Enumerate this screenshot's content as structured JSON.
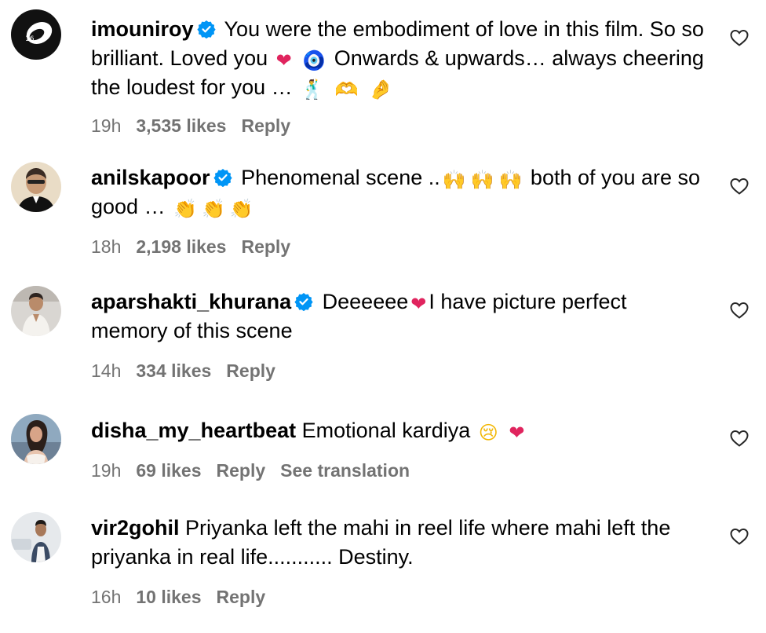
{
  "comments": [
    {
      "username": "imouniroy",
      "verified": true,
      "parts": [
        "You were the embodiment of love in this film. So so brilliant. Loved you",
        "❤",
        "🧿",
        "Onwards & upwards… always cheering the loudest for you …",
        "🕺",
        "🫶",
        "🤌"
      ],
      "time": "19h",
      "likes": "3,535 likes",
      "reply": "Reply"
    },
    {
      "username": "anilskapoor",
      "verified": true,
      "parts": [
        "Phenomenal scene ..",
        "🙌",
        "🙌",
        "🙌",
        "both of you are so good …",
        "👏",
        "👏",
        "👏"
      ],
      "time": "18h",
      "likes": "2,198 likes",
      "reply": "Reply"
    },
    {
      "username": "aparshakti_khurana",
      "verified": true,
      "parts": [
        "Deeeeee",
        "❤",
        "I have picture perfect memory of this scene"
      ],
      "time": "14h",
      "likes": "334 likes",
      "reply": "Reply"
    },
    {
      "username": "disha_my_heartbeat",
      "verified": false,
      "parts": [
        "Emotional kardiya",
        "😢",
        "❤"
      ],
      "time": "19h",
      "likes": "69 likes",
      "reply": "Reply",
      "translate": "See translation"
    },
    {
      "username": "vir2gohil",
      "verified": false,
      "parts": [
        "Priyanka left the mahi in reel life where mahi left the priyanka in real life........... Destiny."
      ],
      "time": "16h",
      "likes": "10 likes",
      "reply": "Reply"
    }
  ],
  "icons": {
    "verified": "verified-badge-icon",
    "like": "heart-outline-icon"
  },
  "colors": {
    "verified_badge": "#0095f6",
    "meta_text": "#737373",
    "red_heart": "#e0245e"
  }
}
